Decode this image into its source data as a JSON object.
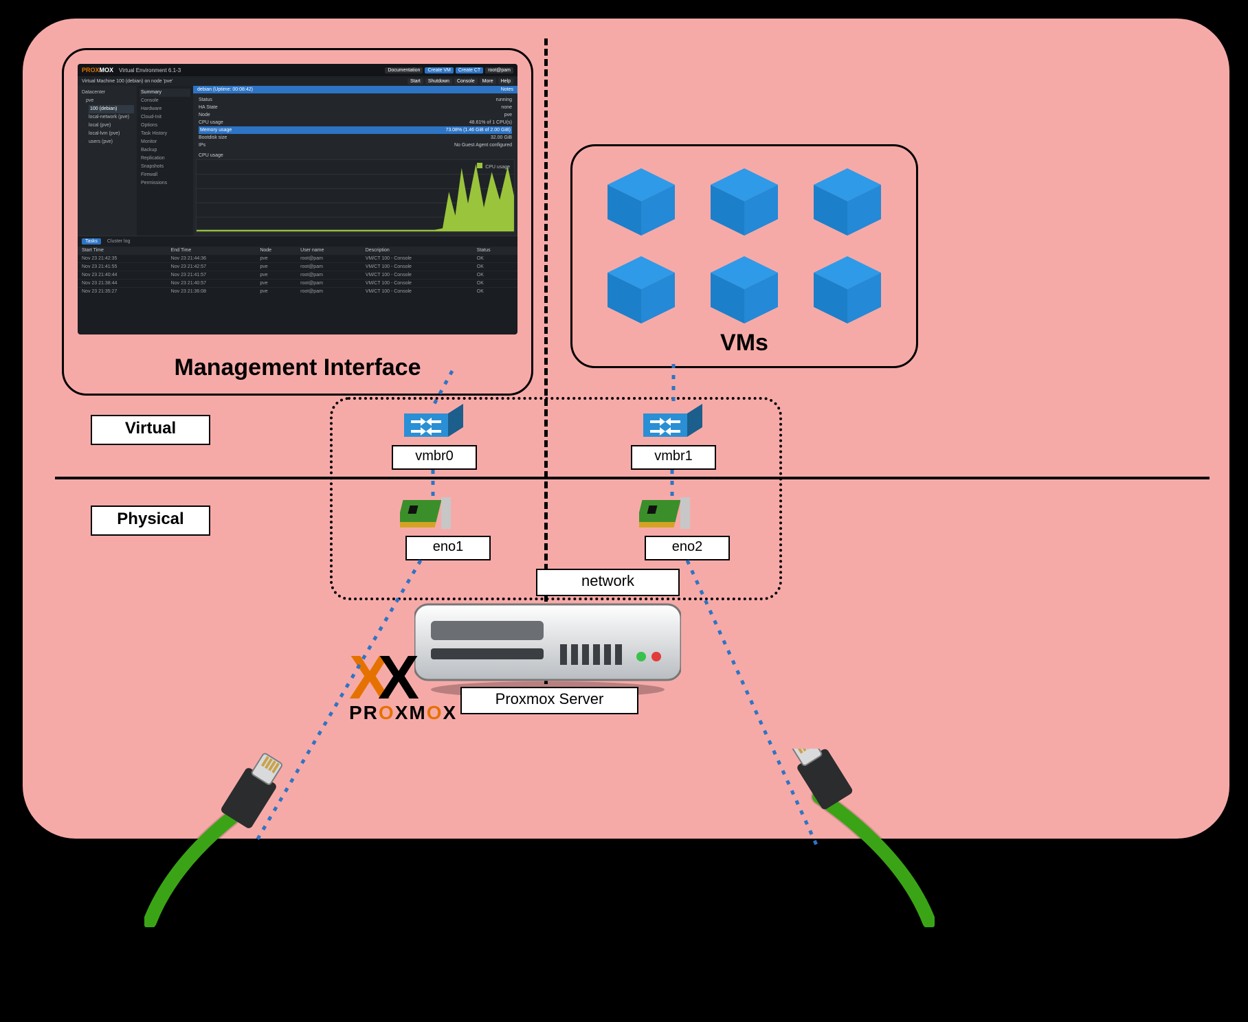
{
  "captions": {
    "management": "Management Interface",
    "vms": "VMs",
    "virtual": "Virtual",
    "physical": "Physical",
    "network": "network",
    "server": "Proxmox Server"
  },
  "bridges": {
    "b0": "vmbr0",
    "b1": "vmbr1"
  },
  "nics": {
    "n0": "eno1",
    "n1": "eno2"
  },
  "logo": {
    "word": "PROXMOX"
  },
  "proxmox_ui": {
    "brand_a": "PROX",
    "brand_b": "MOX",
    "title": "Virtual Environment 6.1-3",
    "header_vm": "Virtual Machine 100 (debian) on node 'pve'",
    "toolbar": {
      "doc": "Documentation",
      "vm": "Create VM",
      "ct": "Create CT",
      "user": "root@pam",
      "start": "Start",
      "shutdown": "Shutdown",
      "console": "Console",
      "more": "More",
      "help": "Help"
    },
    "tree": {
      "dc": "Datacenter",
      "node": "pve",
      "vm": "100 (debian)",
      "s1": "local-network (pve)",
      "s2": "local (pve)",
      "s3": "local-lvm (pve)",
      "s4": "users (pve)"
    },
    "menu": [
      "Summary",
      "Console",
      "Hardware",
      "Cloud-Init",
      "Options",
      "Task History",
      "Monitor",
      "Backup",
      "Replication",
      "Snapshots",
      "Firewall",
      "Permissions"
    ],
    "summary": {
      "title": "debian (Uptime: 00:08:42)",
      "notes": "Notes",
      "status_k": "Status",
      "status_v": "running",
      "ha_k": "HA State",
      "ha_v": "none",
      "node_k": "Node",
      "node_v": "pve",
      "cpu_k": "CPU usage",
      "cpu_v": "48.61% of 1 CPU(s)",
      "mem_k": "Memory usage",
      "mem_v": "73.08% (1.46 GiB of 2.00 GiB)",
      "boot_k": "Bootdisk size",
      "boot_v": "32.00 GiB",
      "ips_k": "IPs",
      "ips_v": "No Guest Agent configured",
      "chart_title": "CPU usage",
      "chart_legend": "CPU usage"
    },
    "tasks": {
      "tab1": "Tasks",
      "tab2": "Cluster log",
      "cols": {
        "start": "Start Time",
        "end": "End Time",
        "node": "Node",
        "user": "User name",
        "desc": "Description",
        "status": "Status"
      },
      "rows": [
        {
          "s": "Nov 23 21:42:35",
          "e": "Nov 23 21:44:36",
          "n": "pve",
          "u": "root@pam",
          "d": "VM/CT 100 - Console",
          "st": "OK"
        },
        {
          "s": "Nov 23 21:41:55",
          "e": "Nov 23 21:42:57",
          "n": "pve",
          "u": "root@pam",
          "d": "VM/CT 100 - Console",
          "st": "OK"
        },
        {
          "s": "Nov 23 21:40:44",
          "e": "Nov 23 21:41:57",
          "n": "pve",
          "u": "root@pam",
          "d": "VM/CT 100 - Console",
          "st": "OK"
        },
        {
          "s": "Nov 23 21:38:44",
          "e": "Nov 23 21:40:57",
          "n": "pve",
          "u": "root@pam",
          "d": "VM/CT 100 - Console",
          "st": "OK"
        },
        {
          "s": "Nov 23 21:35:27",
          "e": "Nov 23 21:36:08",
          "n": "pve",
          "u": "root@pam",
          "d": "VM/CT 100 - Console",
          "st": "OK"
        }
      ]
    }
  }
}
